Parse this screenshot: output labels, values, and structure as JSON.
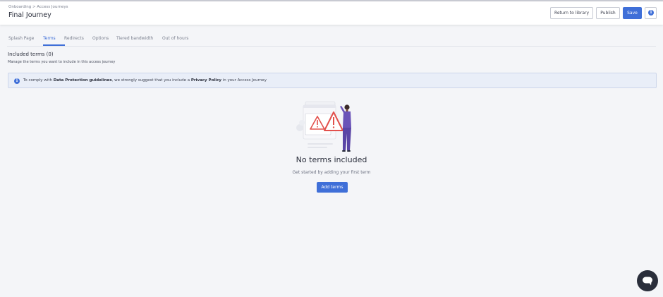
{
  "header": {
    "breadcrumb": "Onboarding > Access Journeys",
    "title": "Final Journey",
    "buttons": {
      "return_label": "Return to library",
      "publish_label": "Publish",
      "save_label": "Save",
      "info_icon": "info-icon"
    }
  },
  "tabs": [
    {
      "label": "Splash Page",
      "active": false
    },
    {
      "label": "Terms",
      "active": true
    },
    {
      "label": "Redirects",
      "active": false
    },
    {
      "label": "Options",
      "active": false
    },
    {
      "label": "Tiered bandwidth",
      "active": false
    },
    {
      "label": "Out of hours",
      "active": false
    }
  ],
  "section": {
    "title": "Included terms (0)",
    "subtitle": "Manage the terms you want to include in this access journey"
  },
  "notice": {
    "icon": "info-icon",
    "prefix": "To comply with ",
    "bold1": "Data Protection guidelines",
    "middle": ", we strongly suggest that you include a ",
    "bold2": "Privacy Policy",
    "suffix": " in your Access Journey"
  },
  "empty_state": {
    "illustration": "warning-illustration",
    "title": "No terms included",
    "subtitle": "Get started by adding your first term",
    "button_label": "Add terms"
  },
  "chat": {
    "icon": "chat-icon"
  },
  "colors": {
    "accent": "#3f6fd8",
    "background": "#f4f5f8",
    "warning": "#e2504c",
    "figure": "#6a53b8"
  }
}
